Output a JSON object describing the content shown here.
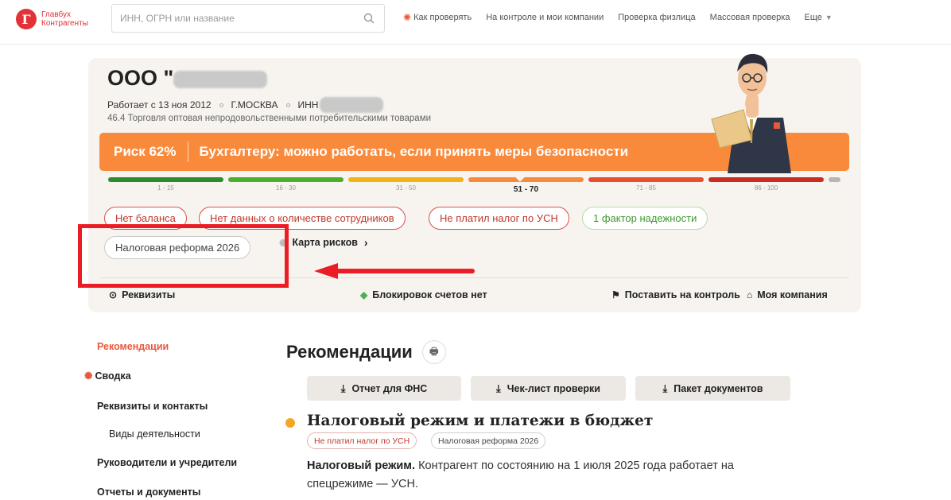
{
  "header": {
    "logo_line1": "Главбух",
    "logo_line2": "Контрагенты",
    "logo_letter": "Г",
    "search_placeholder": "ИНН, ОГРН или название",
    "nav": [
      "Как проверять",
      "На контроле и мои компании",
      "Проверка физлица",
      "Массовая проверка",
      "Еще"
    ]
  },
  "company": {
    "name_prefix": "ООО \"",
    "founded": "Работает с 13 ноя 2012",
    "city": "Г.МОСКВА",
    "inn_label": "ИНН",
    "okved": "46.4 Торговля оптовая непродовольственными потребительскими товарами"
  },
  "risk": {
    "percent_label": "Риск 62%",
    "percent": 62,
    "message": "Бухгалтеру: можно работать, если принять меры безопасности",
    "scale": [
      {
        "label": "1 - 15",
        "color": "#2e8b2e"
      },
      {
        "label": "16 - 30",
        "color": "#4caf2a"
      },
      {
        "label": "31 - 50",
        "color": "#f2b318"
      },
      {
        "label": "51 - 70",
        "color": "#fa8a3b",
        "active": true
      },
      {
        "label": "71 - 85",
        "color": "#e94e30"
      },
      {
        "label": "86 - 100",
        "color": "#cc2b23"
      }
    ],
    "scale_end_color": "#b5b5b5"
  },
  "chips": {
    "no_balance": "Нет баланса",
    "no_staff": "Нет данных о количестве сотрудников",
    "no_usn": "Не платил налог по УСН",
    "reliability": "1 фактор надежности",
    "reform": "Налоговая реформа 2026"
  },
  "risk_map_label": "Карта рисков",
  "card_actions": {
    "requisites": "Реквизиты",
    "blocks": "Блокировок счетов нет",
    "control": "Поставить на контроль",
    "my_company": "Моя компания"
  },
  "sidenav": [
    "Рекомендации",
    "Сводка",
    "Реквизиты и контакты",
    "Виды деятельности",
    "Руководители и учредители",
    "Отчеты и документы"
  ],
  "main": {
    "title": "Рекомендации",
    "buttons": [
      "Отчет для ФНС",
      "Чек-лист проверки",
      "Пакет документов"
    ],
    "section_title": "Налоговый режим и платежи в бюджет",
    "section_chips": [
      "Не платил налог по УСН",
      "Налоговая реформа 2026"
    ],
    "para_bold": "Налоговый режим.",
    "para_text": " Контрагент по состоянию на 1 июля 2025 года работает на спецрежиме — УСН."
  },
  "colors": {
    "brand": "#e23137",
    "risk_banner": "#fa8a3b",
    "annotation": "#ec1c24",
    "accent": "#e8593c"
  }
}
